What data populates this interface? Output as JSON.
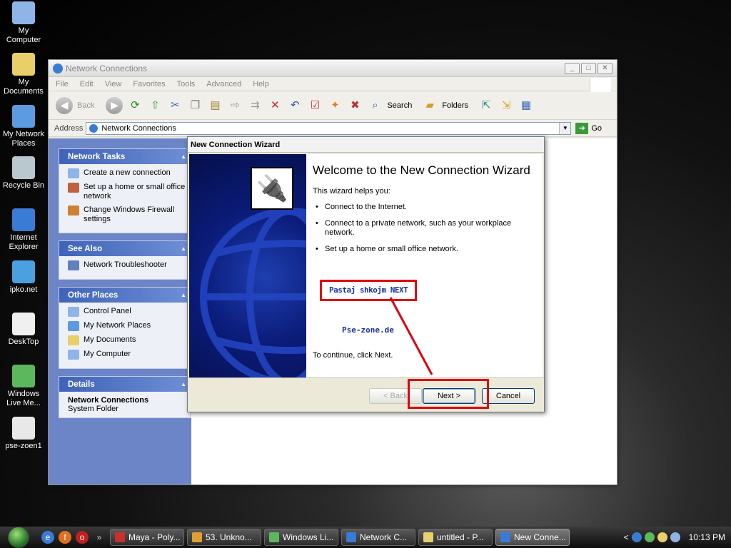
{
  "desktop": {
    "icons": [
      {
        "label": "My Computer",
        "icon": "computer-icon",
        "color": "#8fb4e8"
      },
      {
        "label": "My Documents",
        "icon": "documents-folder-icon",
        "color": "#e8cf6a"
      },
      {
        "label": "My Network Places",
        "icon": "network-places-icon",
        "color": "#5c9be0"
      },
      {
        "label": "Recycle Bin",
        "icon": "recycle-bin-icon",
        "color": "#b9c7cf"
      },
      {
        "label": "Internet Explorer",
        "icon": "internet-explorer-icon",
        "color": "#3a7bd5"
      },
      {
        "label": "ipko.net",
        "icon": "ipko-shortcut-icon",
        "color": "#4aa0e0"
      },
      {
        "label": "DeskTop",
        "icon": "desktop-shortcut-icon",
        "color": "#f0f0f0"
      },
      {
        "label": "Windows Live Me...",
        "icon": "windows-live-messenger-icon",
        "color": "#5cb85c"
      },
      {
        "label": "pse-zoen1",
        "icon": "pse-zoen1-file-icon",
        "color": "#e8e8e8"
      }
    ]
  },
  "explorer": {
    "title": "Network Connections",
    "menu": [
      "File",
      "Edit",
      "View",
      "Favorites",
      "Tools",
      "Advanced",
      "Help"
    ],
    "toolbar": {
      "back_label": "Back",
      "search_label": "Search",
      "folders_label": "Folders"
    },
    "address": {
      "label": "Address",
      "value": "Network Connections",
      "go_label": "Go"
    },
    "panels": {
      "network_tasks": {
        "title": "Network Tasks",
        "items": [
          "Create a new connection",
          "Set up a home or small office network",
          "Change Windows Firewall settings"
        ]
      },
      "see_also": {
        "title": "See Also",
        "items": [
          "Network Troubleshooter"
        ]
      },
      "other_places": {
        "title": "Other Places",
        "items": [
          "Control Panel",
          "My Network Places",
          "My Documents",
          "My Computer"
        ]
      },
      "details": {
        "title": "Details",
        "name": "Network Connections",
        "type": "System Folder"
      }
    }
  },
  "wizard": {
    "title": "New Connection Wizard",
    "heading": "Welcome to the New Connection Wizard",
    "intro": "This wizard helps you:",
    "bullets": [
      "Connect to the Internet.",
      "Connect to a private network, such as your workplace network.",
      "Set up a home or small office network."
    ],
    "annotation_1": "Pastaj shkojm  NEXT",
    "annotation_2": "Pse-zone.de",
    "continue_text": "To continue, click Next.",
    "buttons": {
      "back": "< Back",
      "next": "Next >",
      "cancel": "Cancel"
    },
    "annotation_color": "#e00010"
  },
  "taskbar": {
    "items": [
      {
        "label": "Maya - Poly...",
        "color": "#c9302c",
        "active": false
      },
      {
        "label": "53. Unkno...",
        "color": "#e0a030",
        "active": false
      },
      {
        "label": "Windows Li...",
        "color": "#5cb85c",
        "active": false
      },
      {
        "label": "Network C...",
        "color": "#3a7bd5",
        "active": false
      },
      {
        "label": "untitled - P...",
        "color": "#e8cf6a",
        "active": false
      },
      {
        "label": "New Conne...",
        "color": "#3a7bd5",
        "active": true
      }
    ],
    "clock": "10:13 PM"
  }
}
